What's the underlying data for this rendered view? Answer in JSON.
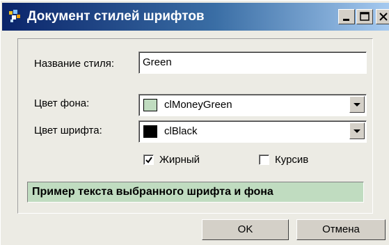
{
  "window": {
    "title": "Документ стилей шрифтов",
    "title_icon": "app-icon",
    "controls": [
      "minimize-icon",
      "maximize-icon",
      "close-icon"
    ]
  },
  "form": {
    "style_name_label": "Название стиля:",
    "style_name_value": "Green",
    "bg_color_label": "Цвет фона:",
    "bg_color_value": "clMoneyGreen",
    "bg_color_swatch": "#c0dcc0",
    "font_color_label": "Цвет шрифта:",
    "font_color_value": "clBlack",
    "font_color_swatch": "#000000",
    "bold_label": "Жирный",
    "bold_checked": true,
    "italic_label": "Курсив",
    "italic_checked": false
  },
  "preview": {
    "text": "Пример текста выбранного шрифта и фона",
    "background": "#c0dcc0",
    "color": "#000000"
  },
  "buttons": {
    "ok_label": "OK",
    "cancel_label": "Отмена"
  }
}
